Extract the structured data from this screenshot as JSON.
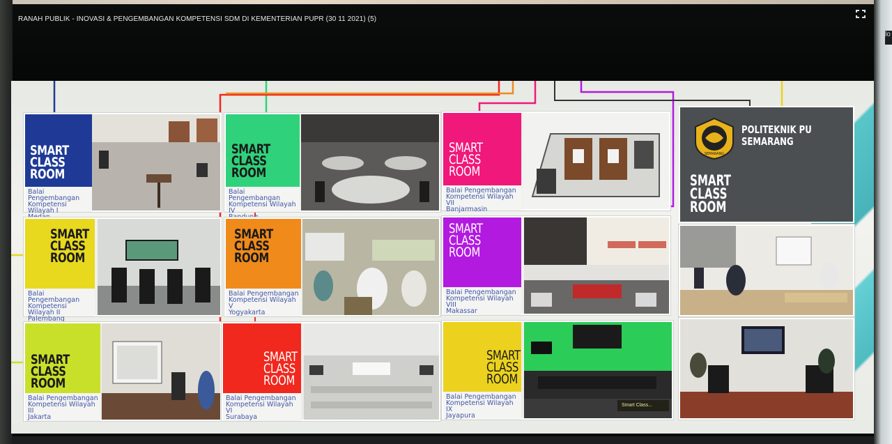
{
  "window": {
    "title": "RANAH PUBLIK - INOVASI & PENGEMBANGAN KOMPETENSI SDM DI KEMENTERIAN PUPR (30 11 2021) (5)"
  },
  "right_panel": {
    "label": "lo"
  },
  "slide": {
    "smart_label": [
      "SMART",
      "CLASS",
      "ROOM"
    ],
    "cards": [
      {
        "id": "medan",
        "caption": [
          "Balai Pengembangan",
          "Kompetensi Wilayah I",
          "Medan"
        ],
        "color": "#1e3a96",
        "text_color": "#ffffff"
      },
      {
        "id": "bandung",
        "caption": [
          "Balai Pengembangan",
          "Kompetensi Wilayah IV",
          "Bandung"
        ],
        "color": "#2fd27a",
        "text_color": "#1a1a1a"
      },
      {
        "id": "banjarmasin",
        "caption": [
          "Balai Pengembangan",
          "Kompetensi Wilayah VII",
          "Banjarmasin"
        ],
        "color": "#f0187a",
        "text_color": "#ffffff"
      },
      {
        "id": "palembang",
        "caption": [
          "Balai Pengembangan",
          "Kompetensi Wilayah II",
          "Palembang"
        ],
        "color": "#e8d81e",
        "text_color": "#1a1a1a"
      },
      {
        "id": "yogyakarta",
        "caption": [
          "Balai Pengembangan",
          "Kompetensi Wilayah V",
          "Yogyakarta"
        ],
        "color": "#f08a1a",
        "text_color": "#1a1a1a"
      },
      {
        "id": "makassar",
        "caption": [
          "Balai Pengembangan",
          "Kompetensi Wilayah VIII",
          "Makassar"
        ],
        "color": "#b21ae0",
        "text_color": "#ffffff"
      },
      {
        "id": "jakarta",
        "caption": [
          "Balai Pengembangan",
          "Kompetensi Wilayah III",
          "Jakarta"
        ],
        "color": "#c9e02a",
        "text_color": "#1a1a1a"
      },
      {
        "id": "surabaya",
        "caption": [
          "Balai Pengembangan",
          "Kompetensi Wilayah VI",
          "Surabaya"
        ],
        "color": "#f0281e",
        "text_color": "#ffffff"
      },
      {
        "id": "jayapura",
        "caption": [
          "Balai Pengembangan",
          "Kompetensi Wilayah IX",
          "Jayapura"
        ],
        "color": "#ecd21e",
        "text_color": "#1a1a1a"
      }
    ],
    "politeknik": {
      "name": [
        "POLITEKNIK PU",
        "SEMARANG"
      ],
      "logo_text": "SEMARANG",
      "color": "#4b4f52"
    },
    "overlay_label": "Smart Class..."
  }
}
